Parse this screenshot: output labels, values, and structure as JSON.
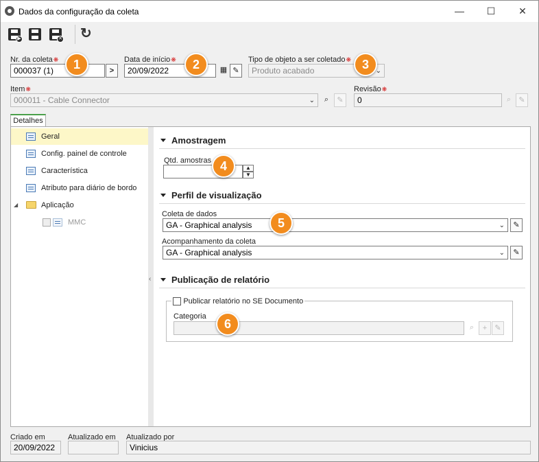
{
  "window": {
    "title": "Dados da configuração da coleta",
    "controls": {
      "minimize": "—",
      "maximize": "☐",
      "close": "✕"
    }
  },
  "toolbar": {
    "buttons": [
      "save-new-icon",
      "save-icon",
      "save-close-icon",
      "refresh-icon"
    ]
  },
  "form": {
    "nr_coleta": {
      "label": "Nr. da coleta",
      "value": "000037 (1)"
    },
    "data_inicio": {
      "label": "Data de início",
      "value": "20/09/2022"
    },
    "tipo_objeto": {
      "label": "Tipo de objeto a ser coletado",
      "value": "Produto acabado"
    },
    "item": {
      "label": "Item",
      "value": "000011 - Cable Connector"
    },
    "revisao": {
      "label": "Revisão",
      "value": "0"
    }
  },
  "tabs": {
    "detalhes": "Detalhes"
  },
  "tree": {
    "items": [
      {
        "label": "Geral"
      },
      {
        "label": "Config. painel de controle"
      },
      {
        "label": "Característica"
      },
      {
        "label": "Atributo para diário de bordo"
      },
      {
        "label": "Aplicação"
      },
      {
        "label": "MMC"
      }
    ]
  },
  "amostragem": {
    "title": "Amostragem",
    "qtd_label": "Qtd. amostras",
    "qtd_value": ""
  },
  "perfil": {
    "title": "Perfil de visualização",
    "coleta_label": "Coleta de dados",
    "coleta_value": "GA - Graphical analysis",
    "acomp_label": "Acompanhamento da coleta",
    "acomp_value": "GA - Graphical analysis"
  },
  "publicacao": {
    "title": "Publicação de relatório",
    "checkbox_label": "Publicar relatório no SE Documento",
    "categoria_label": "Categoria",
    "categoria_value": ""
  },
  "footer": {
    "criado_label": "Criado em",
    "criado_value": "20/09/2022",
    "atualizado_label": "Atualizado em",
    "atualizado_value": "",
    "atualizado_por_label": "Atualizado por",
    "atualizado_por_value": "Vinicius"
  },
  "badges": [
    "1",
    "2",
    "3",
    "4",
    "5",
    "6"
  ],
  "colors": {
    "badge": "#f28c1e",
    "required": "#d42020",
    "selected_row": "#fdf7c8",
    "tab_accent": "#4aa04a"
  }
}
